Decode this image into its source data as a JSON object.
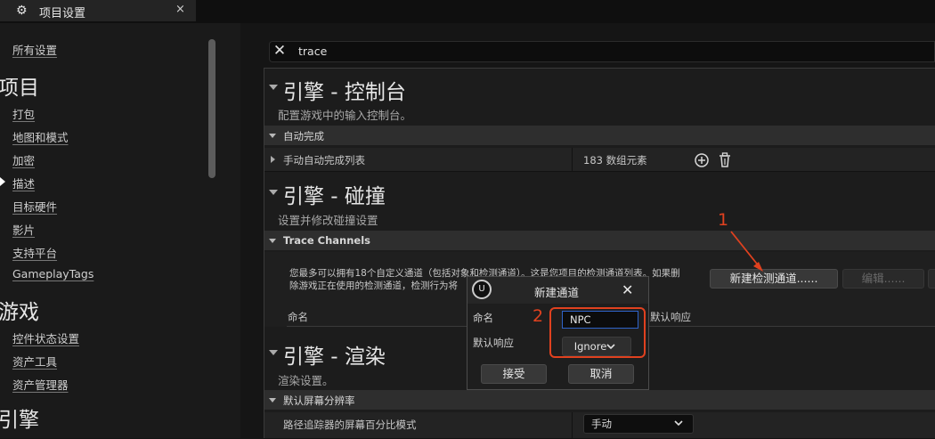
{
  "tab": {
    "title": "项目设置",
    "close": "×"
  },
  "search": {
    "value": "trace"
  },
  "sidebar": {
    "all_settings": "所有设置",
    "sections": [
      {
        "heading": "项目",
        "items": [
          "打包",
          "地图和模式",
          "加密",
          "描述",
          "目标硬件",
          "影片",
          "支持平台",
          "GameplayTags"
        ]
      },
      {
        "heading": "游戏",
        "items": [
          "控件状态设置",
          "资产工具",
          "资产管理器"
        ]
      },
      {
        "heading": "引擎",
        "items": []
      }
    ]
  },
  "console_section": {
    "title": "引擎 - 控制台",
    "desc": "配置游戏中的输入控制台。",
    "category": "自动完成",
    "row_label": "手动自动完成列表",
    "row_value": "183 数组元素"
  },
  "collision_section": {
    "title": "引擎 - 碰撞",
    "desc": "设置并修改碰撞设置",
    "category": "Trace Channels",
    "info_line1": "您最多可以拥有18个自定义通道（包括对象和检测通道）。这是您项目的检测通道列表。如果删",
    "info_line2": "除游戏正在使用的检测通道，检测行为将",
    "new_channel_button": "新建检测通道......",
    "edit_button": "编辑......",
    "col_name": "命名",
    "col_response": "默认响应"
  },
  "render_section": {
    "title": "引擎 - 渲染",
    "desc": "渲染设置。",
    "category": "默认屏幕分辨率",
    "row_label": "路径追踪器的屏幕百分比模式",
    "row_value": "手动"
  },
  "dialog": {
    "title": "新建通道",
    "logo": "U",
    "name_label": "命名",
    "name_value": "NPC",
    "response_label": "默认响应",
    "response_value": "Ignore",
    "accept": "接受",
    "cancel": "取消"
  },
  "annotations": {
    "step1": "1",
    "step2": "2"
  },
  "colors": {
    "annotation": "#e0411f",
    "focus": "#2f63c8"
  }
}
